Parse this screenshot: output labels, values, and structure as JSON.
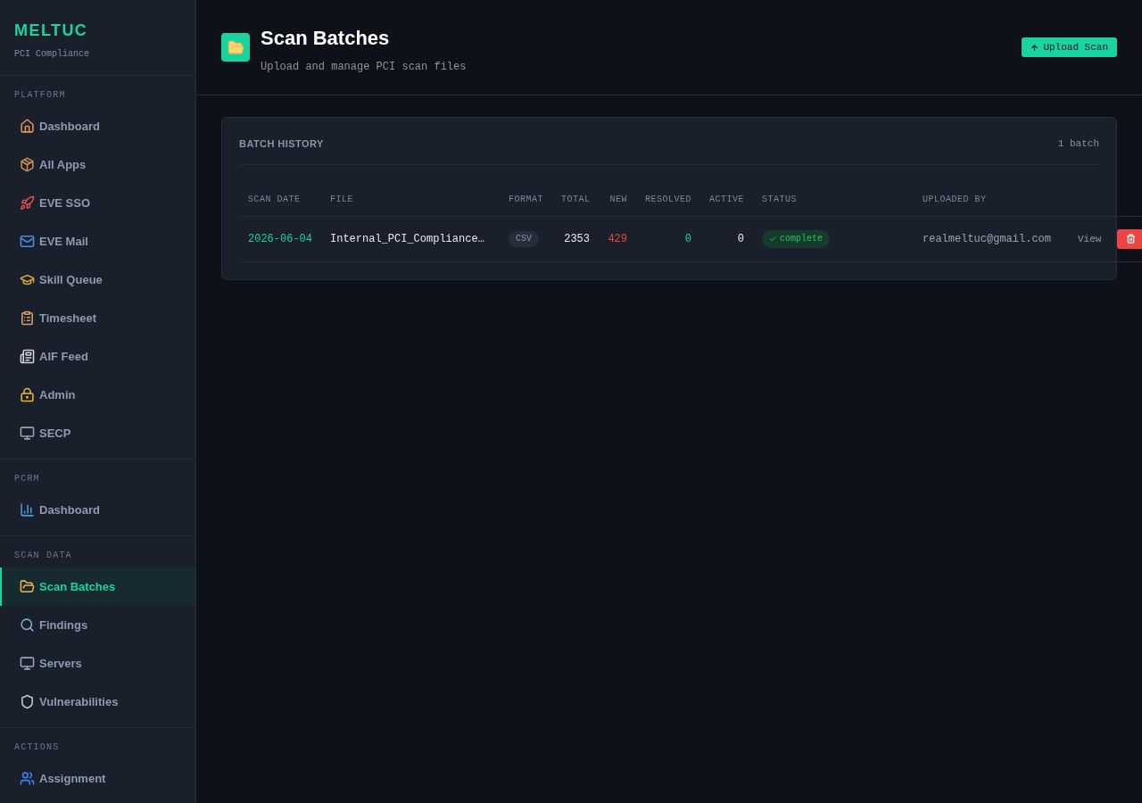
{
  "sidebar": {
    "brand": {
      "name": "MELTUC",
      "subtitle": "PCI Compliance"
    },
    "sections": [
      {
        "label": "PLATFORM",
        "items": [
          {
            "label": "Dashboard",
            "selected": false
          },
          {
            "label": "All Apps",
            "selected": false
          },
          {
            "label": "EVE SSO",
            "selected": false
          },
          {
            "label": "EVE Mail",
            "selected": false
          },
          {
            "label": "Skill Queue",
            "selected": false
          },
          {
            "label": "Timesheet",
            "selected": false
          },
          {
            "label": "AIF Feed",
            "selected": false
          },
          {
            "label": "Admin",
            "selected": false
          },
          {
            "label": "SECP",
            "selected": false
          }
        ]
      },
      {
        "label": "PCRM",
        "items": [
          {
            "label": "Dashboard",
            "selected": false
          }
        ]
      },
      {
        "label": "SCAN DATA",
        "items": [
          {
            "label": "Scan Batches",
            "selected": true
          },
          {
            "label": "Findings",
            "selected": false
          },
          {
            "label": "Servers",
            "selected": false
          },
          {
            "label": "Vulnerabilities",
            "selected": false
          }
        ]
      },
      {
        "label": "ACTIONS",
        "items": [
          {
            "label": "Assignment",
            "selected": false
          }
        ]
      }
    ]
  },
  "header": {
    "title": "Scan Batches",
    "subtitle": "Upload and manage PCI scan files",
    "upload_button": "Upload Scan"
  },
  "batch_history": {
    "title": "BATCH HISTORY",
    "count": "1 batch",
    "columns": [
      "SCAN DATE",
      "FILE",
      "FORMAT",
      "TOTAL",
      "NEW",
      "RESOLVED",
      "ACTIVE",
      "STATUS",
      "UPLOADED BY"
    ],
    "rows": [
      {
        "scan_date": "2026-06-04",
        "file": "Internal_PCI_Compliance…",
        "format": "CSV",
        "total": "2353",
        "new": "429",
        "resolved": "0",
        "active": "0",
        "status": "complete",
        "uploaded_by": "realmeltuc@gmail.com",
        "view": "View"
      }
    ]
  }
}
